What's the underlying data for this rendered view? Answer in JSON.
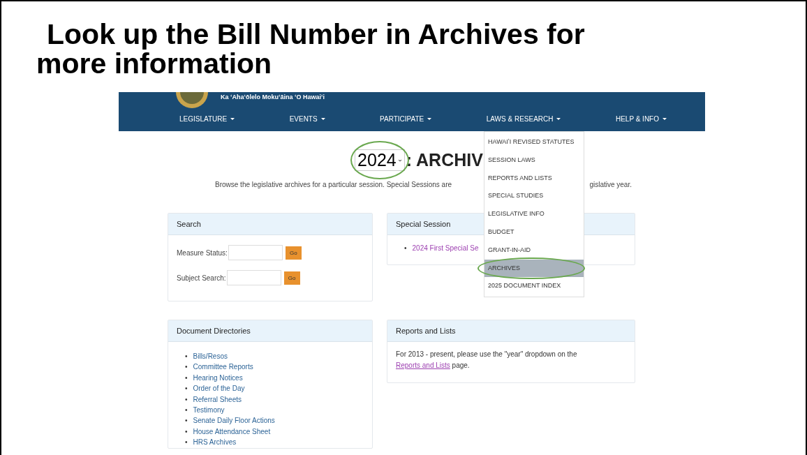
{
  "slide": {
    "title_line_1": "Look up the Bill Number in Archives for",
    "title_line_2": "more information"
  },
  "site": {
    "subtitle": "Ka ʻAhaʻōlelo Mokuʻāina ʻO Hawaiʻi",
    "nav": [
      {
        "label": "LEGISLATURE"
      },
      {
        "label": "EVENTS"
      },
      {
        "label": "PARTICIPATE"
      },
      {
        "label": "LAWS & RESEARCH"
      },
      {
        "label": "HELP & INFO"
      }
    ],
    "menu": [
      {
        "label": "HAWAIʻI REVISED STATUTES",
        "selected": false,
        "highlighted": false
      },
      {
        "label": "SESSION LAWS",
        "selected": false,
        "highlighted": false
      },
      {
        "label": "REPORTS AND LISTS",
        "selected": false,
        "highlighted": false
      },
      {
        "label": "SPECIAL STUDIES",
        "selected": false,
        "highlighted": false
      },
      {
        "label": "LEGISLATIVE INFO",
        "selected": false,
        "highlighted": false
      },
      {
        "label": "BUDGET",
        "selected": false,
        "highlighted": false
      },
      {
        "label": "GRANT-IN-AID",
        "selected": false,
        "highlighted": false
      },
      {
        "label": "ARCHIVES",
        "selected": true,
        "highlighted": true
      },
      {
        "label": "2025 DOCUMENT INDEX",
        "selected": false,
        "highlighted": false
      }
    ]
  },
  "page": {
    "year_select": {
      "value": "2024",
      "highlighted": true
    },
    "heading": ": ARCHIV",
    "intro": "Browse the legislative archives for a particular session. Special Sessions are",
    "intro_end": "gislative year.",
    "search_card": {
      "title": "Search",
      "fields": [
        {
          "label": "Measure Status:",
          "button": "Go"
        },
        {
          "label": "Subject Search:",
          "button": "Go"
        }
      ]
    },
    "bullet": "•",
    "special_card": {
      "title": "Special Session",
      "links": [
        "2024 First Special Se"
      ]
    },
    "directories_card": {
      "title": "Document Directories",
      "links": [
        "Bills/Resos",
        "Committee Reports",
        "Hearing Notices",
        "Order of the Day",
        "Referral Sheets",
        "Testimony",
        "Senate Daily Floor Actions",
        "House Attendance Sheet",
        "HRS Archives"
      ]
    },
    "reports_card": {
      "title": "Reports and Lists",
      "text": "For 2013 - present, please use the \"year\" dropdown on the",
      "link": "Reports and Lists",
      "text_end": "page."
    }
  }
}
